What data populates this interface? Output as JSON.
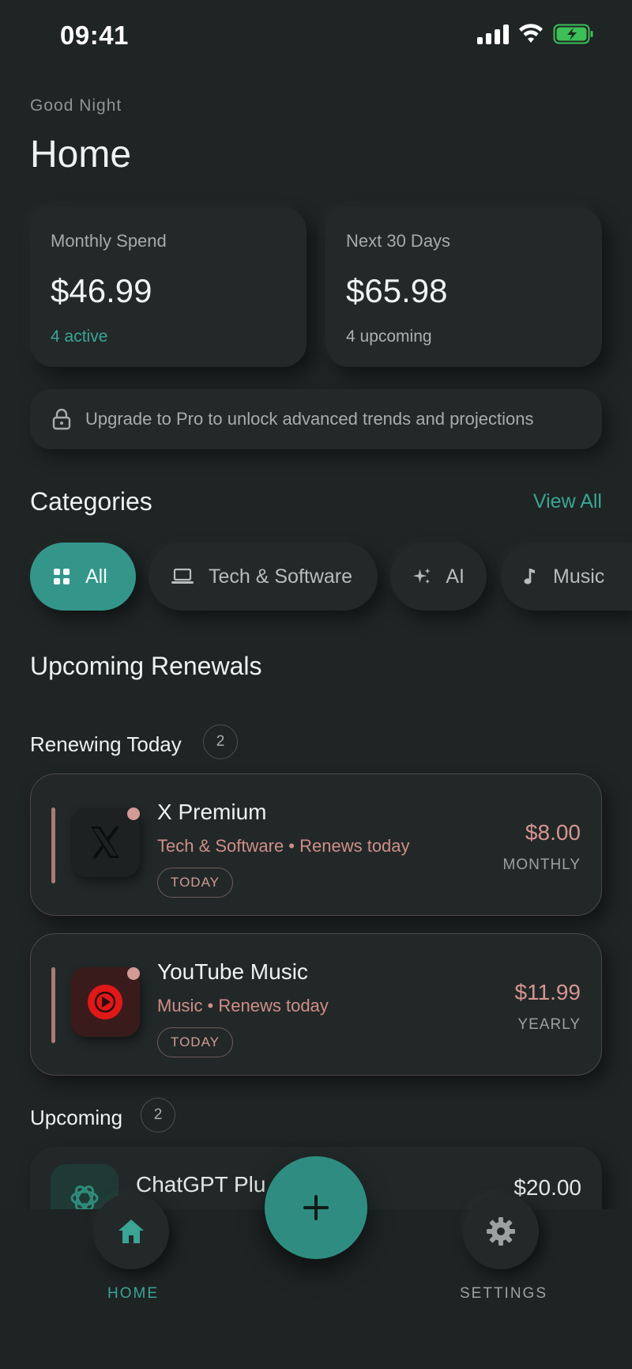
{
  "status": {
    "time": "09:41"
  },
  "header": {
    "greeting": "Good Night",
    "title": "Home"
  },
  "stats": [
    {
      "label": "Monthly Spend",
      "value": "$46.99",
      "sub": "4 active",
      "sub_color": "#3aa595"
    },
    {
      "label": "Next 30 Days",
      "value": "$65.98",
      "sub": "4 upcoming",
      "sub_color": "#aab2b1"
    }
  ],
  "pro_banner": {
    "text": "Upgrade to Pro to unlock advanced trends and projections",
    "icon": "lock-icon"
  },
  "categories": {
    "title": "Categories",
    "view_all": "View All",
    "chips": [
      {
        "label": "All",
        "icon": "grid-icon",
        "active": true
      },
      {
        "label": "Tech & Software",
        "icon": "laptop-icon",
        "active": false
      },
      {
        "label": "AI",
        "icon": "sparkles-icon",
        "active": false
      },
      {
        "label": "Music",
        "icon": "music-note-icon",
        "active": false
      }
    ]
  },
  "renewals": {
    "title": "Upcoming Renewals",
    "today": {
      "label": "Renewing Today",
      "count": "2",
      "items": [
        {
          "name": "X Premium",
          "subtitle": "Tech & Software • Renews today",
          "tag": "TODAY",
          "price": "$8.00",
          "cycle": "MONTHLY",
          "icon": "x-logo-icon"
        },
        {
          "name": "YouTube Music",
          "subtitle": "Music • Renews today",
          "tag": "TODAY",
          "price": "$11.99",
          "cycle": "YEARLY",
          "icon": "youtube-music-icon"
        }
      ]
    },
    "upcoming": {
      "label": "Upcoming",
      "count": "2",
      "items": [
        {
          "name": "ChatGPT Plu",
          "price": "$20.00",
          "icon": "openai-icon"
        }
      ]
    }
  },
  "tabbar": {
    "home_label": "HOME",
    "settings_label": "SETTINGS",
    "accent": "#3aa595"
  }
}
